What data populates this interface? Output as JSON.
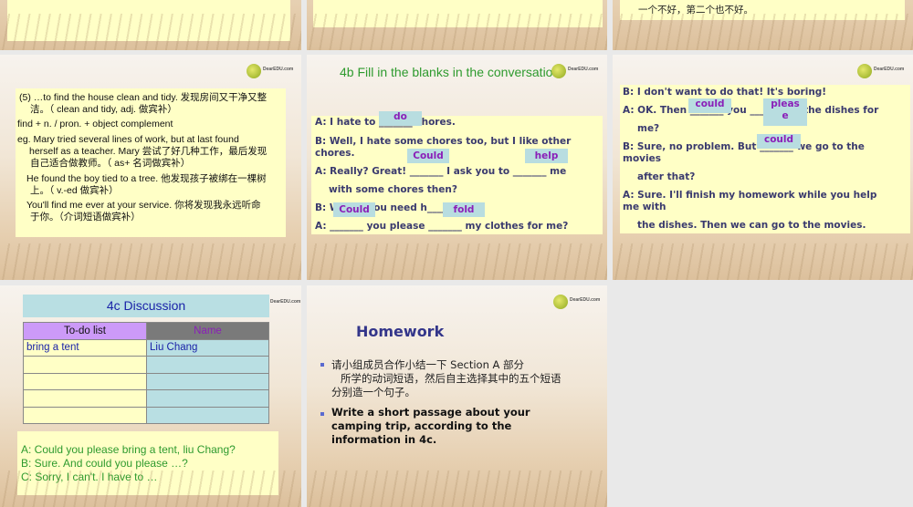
{
  "slides": [
    {
      "id": 1,
      "lines": []
    },
    {
      "id": 2,
      "lines": []
    },
    {
      "id": 3,
      "lines": [
        "一个不好，第二个也不好。"
      ]
    },
    {
      "id": 4,
      "logo": "DearEDU.com",
      "lines": [
        "(5) …to find the house clean and tidy. 发现房间又干净又整",
        "洁。（ clean and tidy, adj. 做宾补）",
        "find + n. / pron. + object complement",
        "eg. Mary tried several lines of work, but at last found",
        "herself as a teacher. Mary 尝试了好几种工作，最后发现",
        "自己适合做教师。（ as+ 名词做宾补）",
        "He found the boy tied to a tree.  他发现孩子被绑在一棵树",
        "上。（ v.-ed 做宾补）",
        "You'll find me ever at your service.  你将发现我永远听命",
        "于你。（介词短语做宾补）"
      ]
    },
    {
      "id": 5,
      "logo": "DearEDU.com",
      "title": "4b Fill in the blanks in the conversation.",
      "lines": [
        "A: I hate to _______ chores.",
        "B: Well, I hate some chores too, but I like other",
        "chores.",
        "A: Really? Great! _______ I ask you to _______ me",
        "with some chores then?",
        "B: W_____ you need h_____n?",
        "A: _______ you please _______ my clothes for me?"
      ],
      "answers": [
        "do",
        "Could",
        "help",
        "Could",
        "fold"
      ]
    },
    {
      "id": 6,
      "logo": "DearEDU.com",
      "lines": [
        "B: I don't want to do that! It's boring!",
        "A: OK. Then _______ you _______ do the dishes for",
        "me?",
        "B: Sure, no problem. But _______ we go to the",
        "movies",
        "after that?",
        "A: Sure. I'll finish my homework while you help",
        "me with",
        "the dishes. Then we can go to the movies."
      ],
      "answers": [
        "could",
        "pleas",
        "e",
        "could"
      ]
    },
    {
      "id": 7,
      "logo": "DearEDU.com",
      "title": "4c Discussion",
      "table": {
        "headers": [
          "To-do list",
          "Name"
        ],
        "rows": [
          [
            "bring a tent",
            "Liu Chang"
          ],
          [
            "",
            ""
          ],
          [
            "",
            ""
          ],
          [
            "",
            ""
          ],
          [
            "",
            ""
          ]
        ]
      },
      "lines": [
        "A: Could you please bring a tent, liu Chang?",
        "B: Sure. And could you please …?",
        "C: Sorry, I can't. I have to …"
      ]
    },
    {
      "id": 8,
      "logo": "DearEDU.com",
      "title": "Homework",
      "bullets": [
        {
          "lines": [
            "请小组成员合作小结一下 Section A 部分",
            "所学的动词短语，然后自主选择其中的五个短语",
            "分别造一个句子。"
          ]
        },
        {
          "lines": [
            "Write a short passage about your",
            "camping trip, according to the",
            "information in 4c."
          ]
        }
      ]
    }
  ],
  "colors": {
    "box": "#ffffc6",
    "answer_bg": "#b8dde0",
    "answer_text": "#8a1fb8",
    "title_green": "#2e9a2e",
    "dialog_blue": "#3a3a6e"
  }
}
